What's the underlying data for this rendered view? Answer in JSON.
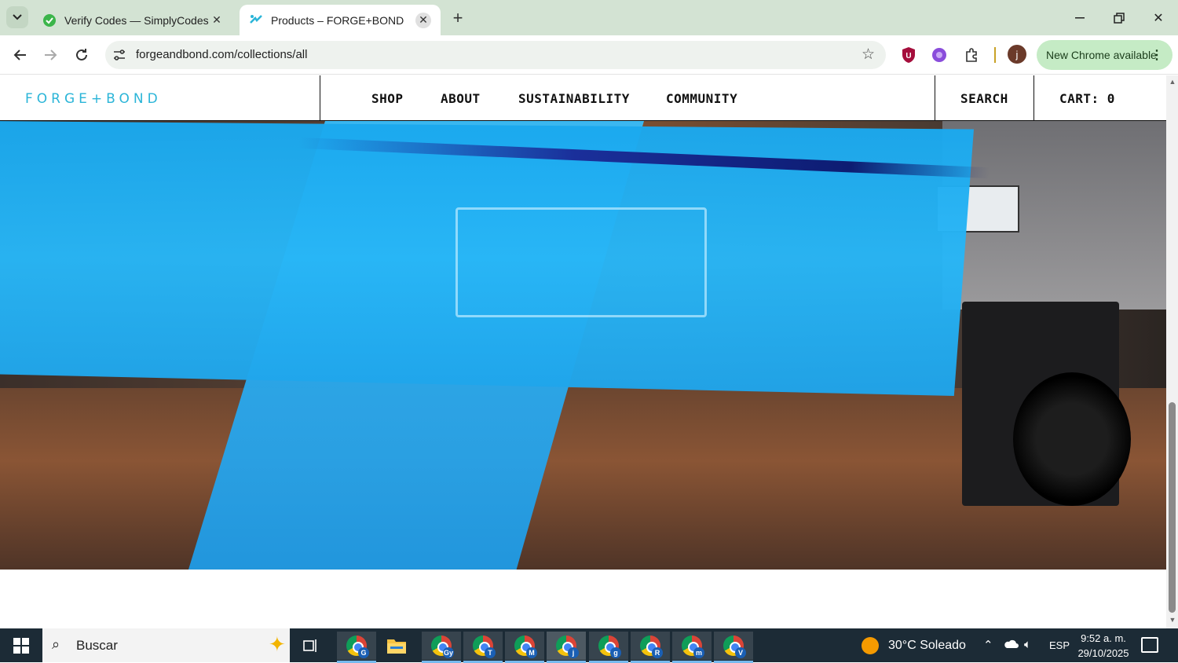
{
  "browser": {
    "tabs": [
      {
        "title": "Verify Codes — SimplyCodes",
        "active": false,
        "favicon": "simplycodes-icon"
      },
      {
        "title": "Products – FORGE+BOND",
        "active": true,
        "favicon": "forgebond-icon"
      }
    ],
    "url": "forgeandbond.com/collections/all",
    "new_chrome_label": "New Chrome available",
    "avatar_letter": "j"
  },
  "site": {
    "logo": "FORGE+BOND",
    "nav": {
      "shop": "SHOP",
      "about": "ABOUT",
      "sustainability": "SUSTAINABILITY",
      "community": "COMMUNITY"
    },
    "search": "SEARCH",
    "cart": "CART: 0",
    "accent": "#2bb5d8"
  },
  "taskbar": {
    "search_placeholder": "Buscar",
    "pinned_badges": [
      "G",
      "Gy",
      "T",
      "M",
      "j",
      "g",
      "R",
      "m",
      "V"
    ],
    "weather": "30°C  Soleado",
    "language": "ESP",
    "time": "9:52 a. m.",
    "date": "29/10/2025"
  }
}
